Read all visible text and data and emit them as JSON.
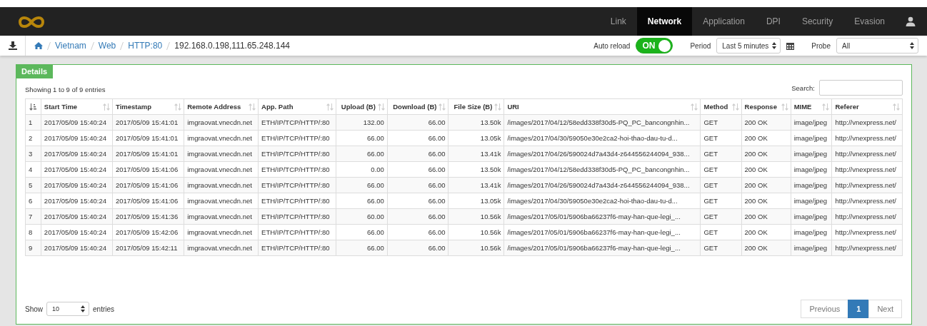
{
  "nav": {
    "tabs": [
      {
        "label": "Link",
        "selected": false
      },
      {
        "label": "Network",
        "selected": true
      },
      {
        "label": "Application",
        "selected": false
      },
      {
        "label": "DPI",
        "selected": false
      },
      {
        "label": "Security",
        "selected": false
      },
      {
        "label": "Evasion",
        "selected": false
      }
    ]
  },
  "breadcrumb": {
    "links": [
      "Vietnam",
      "Web",
      "HTTP:80"
    ],
    "current": "192.168.0.198,111.65.248.144"
  },
  "auto_reload": {
    "label": "Auto reload",
    "on": true,
    "text": "ON"
  },
  "period": {
    "label": "Period",
    "value": "Last 5 minutes"
  },
  "probe": {
    "label": "Probe",
    "value": "All"
  },
  "panel": {
    "title": "Details",
    "info": "Showing 1 to 9 of 9 entries",
    "search_label": "Search:"
  },
  "table": {
    "columns": [
      {
        "sorted": true
      },
      {
        "label": "Start Time",
        "sorted": false
      },
      {
        "label": "Timestamp",
        "sorted": false
      },
      {
        "label": "Remote Address",
        "sorted": false
      },
      {
        "label": "App. Path",
        "sorted": false
      },
      {
        "label": "Upload (B)",
        "sorted": false
      },
      {
        "label": "Download (B)",
        "sorted": false
      },
      {
        "label": "File Size (B)",
        "sorted": false
      },
      {
        "label": "URI",
        "sorted": false
      },
      {
        "label": "Method",
        "sorted": false
      },
      {
        "label": "Response",
        "sorted": false
      },
      {
        "label": "MIME",
        "sorted": false
      },
      {
        "label": "Referer",
        "sorted": false
      }
    ],
    "rows": [
      [
        "1",
        "2017/05/09 15:40:24",
        "2017/05/09 15:41:01",
        "imgraovat.vnecdn.net",
        "ETH/IP/TCP/HTTP/:80",
        "132.00",
        "66.00",
        "13.50k",
        "/images/2017/04/12/58edd338f30d5-PQ_PC_bancongnhin...",
        "GET",
        "200 OK",
        "image/jpeg",
        "http://vnexpress.net/"
      ],
      [
        "2",
        "2017/05/09 15:40:24",
        "2017/05/09 15:41:01",
        "imgraovat.vnecdn.net",
        "ETH/IP/TCP/HTTP/:80",
        "66.00",
        "66.00",
        "13.05k",
        "/images/2017/04/30/59050e30e2ca2-hoi-thao-dau-tu-d...",
        "GET",
        "200 OK",
        "image/jpeg",
        "http://vnexpress.net/"
      ],
      [
        "3",
        "2017/05/09 15:40:24",
        "2017/05/09 15:41:01",
        "imgraovat.vnecdn.net",
        "ETH/IP/TCP/HTTP/:80",
        "66.00",
        "66.00",
        "13.41k",
        "/images/2017/04/26/590024d7a43d4-z644556244094_938...",
        "GET",
        "200 OK",
        "image/jpeg",
        "http://vnexpress.net/"
      ],
      [
        "4",
        "2017/05/09 15:40:24",
        "2017/05/09 15:41:06",
        "imgraovat.vnecdn.net",
        "ETH/IP/TCP/HTTP/:80",
        "0.00",
        "66.00",
        "13.50k",
        "/images/2017/04/12/58edd338f30d5-PQ_PC_bancongnhin...",
        "GET",
        "200 OK",
        "image/jpeg",
        "http://vnexpress.net/"
      ],
      [
        "5",
        "2017/05/09 15:40:24",
        "2017/05/09 15:41:06",
        "imgraovat.vnecdn.net",
        "ETH/IP/TCP/HTTP/:80",
        "66.00",
        "66.00",
        "13.41k",
        "/images/2017/04/26/590024d7a43d4-z644556244094_938...",
        "GET",
        "200 OK",
        "image/jpeg",
        "http://vnexpress.net/"
      ],
      [
        "6",
        "2017/05/09 15:40:24",
        "2017/05/09 15:41:06",
        "imgraovat.vnecdn.net",
        "ETH/IP/TCP/HTTP/:80",
        "66.00",
        "66.00",
        "13.05k",
        "/images/2017/04/30/59050e30e2ca2-hoi-thao-dau-tu-d...",
        "GET",
        "200 OK",
        "image/jpeg",
        "http://vnexpress.net/"
      ],
      [
        "7",
        "2017/05/09 15:40:24",
        "2017/05/09 15:41:36",
        "imgraovat.vnecdn.net",
        "ETH/IP/TCP/HTTP/:80",
        "60.00",
        "66.00",
        "10.56k",
        "/images/2017/05/01/5906ba66237f6-may-han-que-legi_...",
        "GET",
        "200 OK",
        "image/jpeg",
        "http://vnexpress.net/"
      ],
      [
        "8",
        "2017/05/09 15:40:24",
        "2017/05/09 15:42:06",
        "imgraovat.vnecdn.net",
        "ETH/IP/TCP/HTTP/:80",
        "66.00",
        "66.00",
        "10.56k",
        "/images/2017/05/01/5906ba66237f6-may-han-que-legi_...",
        "GET",
        "200 OK",
        "image/jpeg",
        "http://vnexpress.net/"
      ],
      [
        "9",
        "2017/05/09 15:40:24",
        "2017/05/09 15:42:11",
        "imgraovat.vnecdn.net",
        "ETH/IP/TCP/HTTP/:80",
        "66.00",
        "66.00",
        "10.56k",
        "/images/2017/05/01/5906ba66237f6-may-han-que-legi_...",
        "GET",
        "200 OK",
        "image/jpeg",
        "http://vnexpress.net/"
      ]
    ]
  },
  "length": {
    "before": "Show",
    "value": "10",
    "after": "entries"
  },
  "pagination": [
    {
      "label": "Previous",
      "selected": false
    },
    {
      "label": "1",
      "selected": true
    },
    {
      "label": "Next",
      "selected": false
    }
  ]
}
